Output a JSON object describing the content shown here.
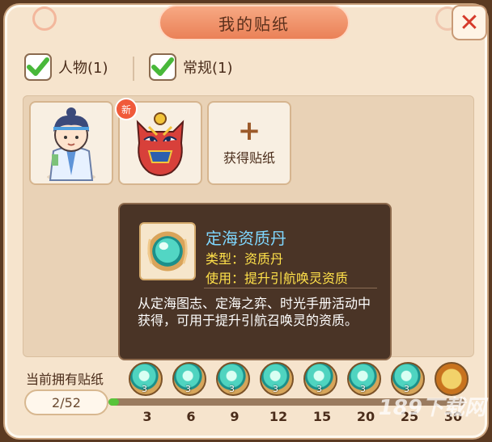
{
  "window": {
    "title": "我的贴纸",
    "close_symbol": "✕"
  },
  "filters": [
    {
      "label": "人物(1)",
      "checked": true
    },
    {
      "label": "常规(1)",
      "checked": true
    }
  ],
  "stickers": [
    {
      "kind": "character",
      "new": false
    },
    {
      "kind": "mask",
      "new": true,
      "badge": "新"
    }
  ],
  "get_slot": {
    "label": "获得贴纸",
    "icon": "plus-icon"
  },
  "tooltip": {
    "name": "定海资质丹",
    "type_line": "类型：资质丹",
    "use_line": "使用：提升引航唤灵资质",
    "description": "从定海图志、定海之弈、时光手册活动中获得，可用于提升引航召唤灵的资质。"
  },
  "progress": {
    "label": "当前拥有贴纸",
    "count_text": "2/52",
    "fill_fraction": 0.03,
    "milestones": [
      {
        "value": "3",
        "reward_count": "3",
        "icon": "pearl-medallion-icon"
      },
      {
        "value": "6",
        "reward_count": "3",
        "icon": "pearl-medallion-icon"
      },
      {
        "value": "9",
        "reward_count": "3",
        "icon": "pearl-medallion-icon"
      },
      {
        "value": "12",
        "reward_count": "3",
        "icon": "pearl-medallion-icon"
      },
      {
        "value": "15",
        "reward_count": "3",
        "icon": "pearl-medallion-icon"
      },
      {
        "value": "20",
        "reward_count": "3",
        "icon": "pearl-medallion-icon"
      },
      {
        "value": "25",
        "reward_count": "3",
        "icon": "pearl-medallion-icon"
      },
      {
        "value": "30",
        "reward_count": "",
        "icon": "gift-scroll-icon"
      }
    ]
  },
  "watermark": "189下载网",
  "colors": {
    "accent": "#ea8157",
    "panel": "#f6e4cd",
    "tooltip_bg": "#4a3426",
    "name_blue": "#7fd7ff",
    "stat_yellow": "#ffe14a",
    "progress_green": "#58c43a"
  }
}
